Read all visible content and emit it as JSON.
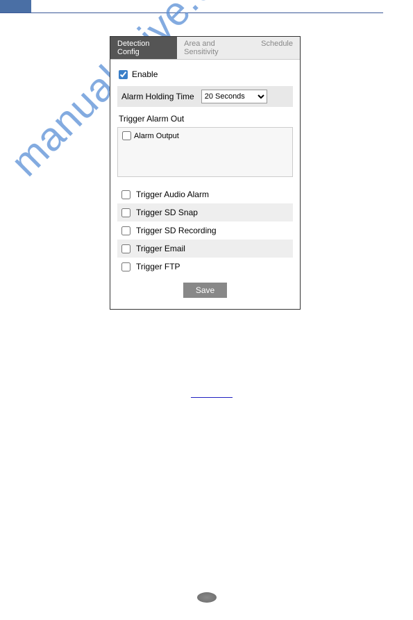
{
  "tabs": {
    "detection": "Detection Config",
    "area": "Area and Sensitivity",
    "schedule": "Schedule"
  },
  "enable_label": "Enable",
  "holding": {
    "label": "Alarm Holding Time",
    "value": "20 Seconds"
  },
  "trigger_out_label": "Trigger Alarm Out",
  "alarm_output_label": "Alarm Output",
  "triggers": {
    "audio": "Trigger Audio Alarm",
    "snap": "Trigger SD Snap",
    "recording": "Trigger SD Recording",
    "email": "Trigger Email",
    "ftp": "Trigger FTP"
  },
  "save_label": "Save",
  "watermark_text": "manualshive.com"
}
